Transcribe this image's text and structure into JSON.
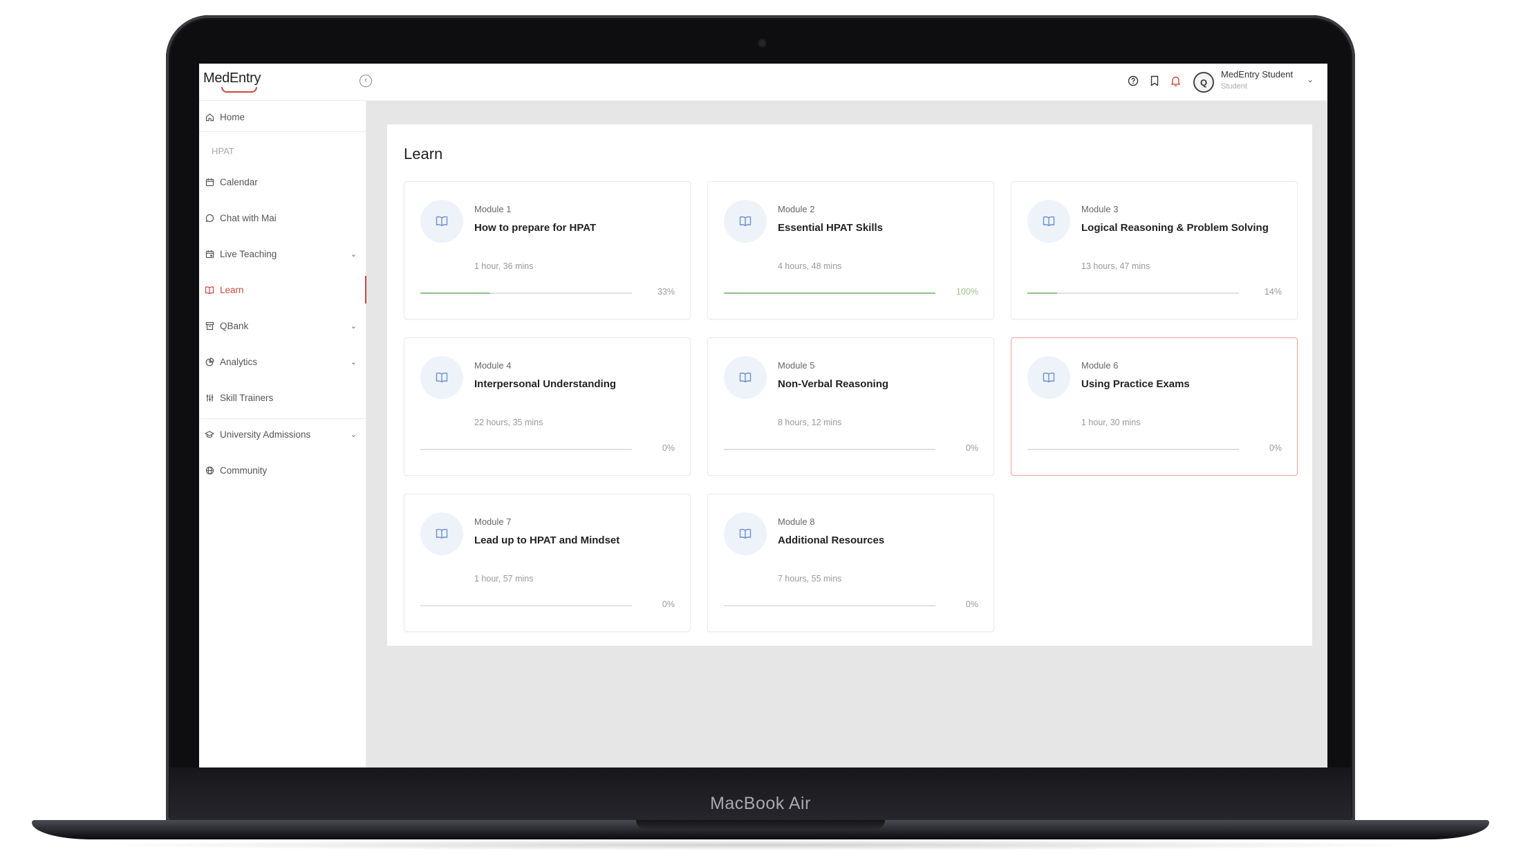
{
  "device": {
    "label": "MacBook Air"
  },
  "app": {
    "logo": "MedEntry",
    "user": {
      "name": "MedEntry Student",
      "role": "Student",
      "initial": "Q"
    }
  },
  "sidebar": {
    "items": [
      {
        "label": "Home",
        "icon": "home-icon",
        "name": "sidebar-item-home",
        "caret": false
      },
      {
        "label": "Calendar",
        "icon": "calendar-icon",
        "name": "sidebar-item-calendar",
        "caret": false
      },
      {
        "label": "Chat with Mai",
        "icon": "chat-icon",
        "name": "sidebar-item-chat",
        "caret": false
      },
      {
        "label": "Live Teaching",
        "icon": "live-teaching-icon",
        "name": "sidebar-item-live-teaching",
        "caret": true
      },
      {
        "label": "Learn",
        "icon": "book-icon",
        "name": "sidebar-item-learn",
        "caret": false,
        "active": true
      },
      {
        "label": "QBank",
        "icon": "archive-icon",
        "name": "sidebar-item-qbank",
        "caret": true
      },
      {
        "label": "Analytics",
        "icon": "pie-chart-icon",
        "name": "sidebar-item-analytics",
        "caret": true
      },
      {
        "label": "Skill Trainers",
        "icon": "sliders-icon",
        "name": "sidebar-item-skill-trainers",
        "caret": false
      },
      {
        "label": "University Admissions",
        "icon": "graduation-cap-icon",
        "name": "sidebar-item-university-admissions",
        "caret": true
      },
      {
        "label": "Community",
        "icon": "globe-icon",
        "name": "sidebar-item-community",
        "caret": false
      }
    ],
    "section_label": "HPAT"
  },
  "page": {
    "title": "Learn"
  },
  "modules": [
    {
      "label": "Module 1",
      "title": "How to prepare for HPAT",
      "duration": "1 hour, 36 mins",
      "progress": 33,
      "progress_text": "33%"
    },
    {
      "label": "Module 2",
      "title": "Essential HPAT Skills",
      "duration": "4 hours, 48 mins",
      "progress": 100,
      "progress_text": "100%"
    },
    {
      "label": "Module 3",
      "title": "Logical Reasoning & Problem Solving",
      "duration": "13 hours, 47 mins",
      "progress": 14,
      "progress_text": "14%"
    },
    {
      "label": "Module 4",
      "title": "Interpersonal Understanding",
      "duration": "22 hours, 35 mins",
      "progress": 0,
      "progress_text": "0%"
    },
    {
      "label": "Module 5",
      "title": "Non-Verbal Reasoning",
      "duration": "8 hours, 12 mins",
      "progress": 0,
      "progress_text": "0%"
    },
    {
      "label": "Module 6",
      "title": "Using Practice Exams",
      "duration": "1 hour, 30 mins",
      "progress": 0,
      "progress_text": "0%",
      "highlighted": true
    },
    {
      "label": "Module 7",
      "title": "Lead up to HPAT and Mindset",
      "duration": "1 hour, 57 mins",
      "progress": 0,
      "progress_text": "0%"
    },
    {
      "label": "Module 8",
      "title": "Additional Resources",
      "duration": "7 hours, 55 mins",
      "progress": 0,
      "progress_text": "0%"
    }
  ],
  "colors": {
    "accent": "#c9473f",
    "progress_fill": "#8fc28a",
    "module_icon_bg": "#eef3fa",
    "module_icon": "#6b8fd0"
  }
}
